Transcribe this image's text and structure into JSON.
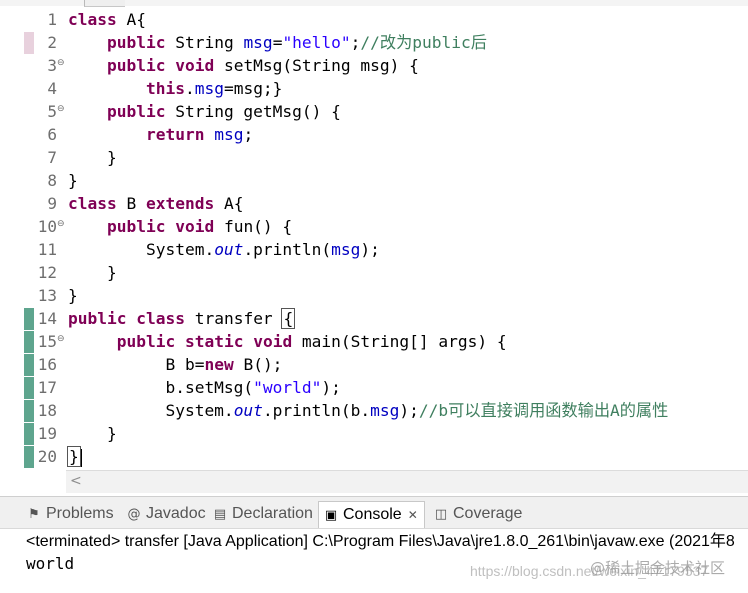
{
  "editor": {
    "line_numbers": [
      "1",
      "2",
      "3",
      "4",
      "5",
      "6",
      "7",
      "8",
      "9",
      "10",
      "11",
      "12",
      "13",
      "14",
      "15",
      "16",
      "17",
      "18",
      "19",
      "20"
    ],
    "lines": [
      [
        {
          "t": "kw",
          "v": "class"
        },
        {
          "t": "p",
          "v": " A{"
        }
      ],
      [
        {
          "t": "p",
          "v": "    "
        },
        {
          "t": "kw",
          "v": "public"
        },
        {
          "t": "p",
          "v": " String "
        },
        {
          "t": "fld",
          "v": "msg"
        },
        {
          "t": "p",
          "v": "="
        },
        {
          "t": "str",
          "v": "\"hello\""
        },
        {
          "t": "p",
          "v": ";"
        },
        {
          "t": "cm",
          "v": "//改为public后"
        }
      ],
      [
        {
          "t": "p",
          "v": "    "
        },
        {
          "t": "kw",
          "v": "public"
        },
        {
          "t": "p",
          "v": " "
        },
        {
          "t": "kw",
          "v": "void"
        },
        {
          "t": "p",
          "v": " setMsg(String msg) {"
        }
      ],
      [
        {
          "t": "p",
          "v": "        "
        },
        {
          "t": "kw",
          "v": "this"
        },
        {
          "t": "p",
          "v": "."
        },
        {
          "t": "fld",
          "v": "msg"
        },
        {
          "t": "p",
          "v": "=msg;}"
        }
      ],
      [
        {
          "t": "p",
          "v": "    "
        },
        {
          "t": "kw",
          "v": "public"
        },
        {
          "t": "p",
          "v": " String getMsg() {"
        }
      ],
      [
        {
          "t": "p",
          "v": "        "
        },
        {
          "t": "kw",
          "v": "return"
        },
        {
          "t": "p",
          "v": " "
        },
        {
          "t": "fld",
          "v": "msg"
        },
        {
          "t": "p",
          "v": ";"
        }
      ],
      [
        {
          "t": "p",
          "v": "    }"
        }
      ],
      [
        {
          "t": "p",
          "v": "}"
        }
      ],
      [
        {
          "t": "kw",
          "v": "class"
        },
        {
          "t": "p",
          "v": " B "
        },
        {
          "t": "kw",
          "v": "extends"
        },
        {
          "t": "p",
          "v": " A{"
        }
      ],
      [
        {
          "t": "p",
          "v": "    "
        },
        {
          "t": "kw",
          "v": "public"
        },
        {
          "t": "p",
          "v": " "
        },
        {
          "t": "kw",
          "v": "void"
        },
        {
          "t": "p",
          "v": " fun() {"
        }
      ],
      [
        {
          "t": "p",
          "v": "        System."
        },
        {
          "t": "stat",
          "v": "out"
        },
        {
          "t": "p",
          "v": ".println("
        },
        {
          "t": "fld",
          "v": "msg"
        },
        {
          "t": "p",
          "v": ");"
        }
      ],
      [
        {
          "t": "p",
          "v": "    }"
        }
      ],
      [
        {
          "t": "p",
          "v": "}"
        }
      ],
      [
        {
          "t": "kw",
          "v": "public"
        },
        {
          "t": "p",
          "v": " "
        },
        {
          "t": "kw",
          "v": "class"
        },
        {
          "t": "p",
          "v": " transfer "
        },
        {
          "t": "cur",
          "v": "{"
        }
      ],
      [
        {
          "t": "p",
          "v": "     "
        },
        {
          "t": "kw",
          "v": "public"
        },
        {
          "t": "p",
          "v": " "
        },
        {
          "t": "kw",
          "v": "static"
        },
        {
          "t": "p",
          "v": " "
        },
        {
          "t": "kw",
          "v": "void"
        },
        {
          "t": "p",
          "v": " main(String[] args) {"
        }
      ],
      [
        {
          "t": "p",
          "v": "          B b="
        },
        {
          "t": "kw",
          "v": "new"
        },
        {
          "t": "p",
          "v": " B();"
        }
      ],
      [
        {
          "t": "p",
          "v": "          b.setMsg("
        },
        {
          "t": "str",
          "v": "\"world\""
        },
        {
          "t": "p",
          "v": ");"
        }
      ],
      [
        {
          "t": "p",
          "v": "          System."
        },
        {
          "t": "stat",
          "v": "out"
        },
        {
          "t": "p",
          "v": ".println(b."
        },
        {
          "t": "fld",
          "v": "msg"
        },
        {
          "t": "p",
          "v": ");"
        },
        {
          "t": "cm",
          "v": "//b可以直接调用函数输出A的属性"
        }
      ],
      [
        {
          "t": "p",
          "v": "    }"
        }
      ],
      [
        {
          "t": "cur",
          "v": "}"
        },
        {
          "t": "caret",
          "v": ""
        }
      ]
    ],
    "fold_lines": [
      3,
      5,
      10,
      15
    ],
    "fold_glyph": "⊖",
    "change_marker_lines": [
      14,
      15,
      16,
      17,
      18,
      19,
      20
    ],
    "current_marker_line": 2,
    "scroll_left_arrow": "<"
  },
  "views": {
    "tabs": [
      {
        "label": "Problems",
        "icon": "problems-icon",
        "glyph": "⚑"
      },
      {
        "label": "Javadoc",
        "icon": "javadoc-icon",
        "glyph": "@"
      },
      {
        "label": "Declaration",
        "icon": "declaration-icon",
        "glyph": "▤"
      },
      {
        "label": "Console",
        "icon": "console-icon",
        "glyph": "▣"
      },
      {
        "label": "Coverage",
        "icon": "coverage-icon",
        "glyph": "◫"
      }
    ],
    "active_tab": "Console",
    "close_glyph": "✕"
  },
  "console": {
    "terminated": "<terminated> transfer [Java Application] C:\\Program Files\\Java\\jre1.8.0_261\\bin\\javaw.exe  (2021年8",
    "output": "world",
    "watermark_url": "https://blog.csdn.net/weixin_47179537",
    "watermark_brand": "@稀土掘金技术社区"
  },
  "colors": {
    "keyword": "#7f0055",
    "field": "#0000c0",
    "string": "#2a00ff",
    "comment": "#3f7f5f",
    "change_marker": "#5ea58e"
  }
}
